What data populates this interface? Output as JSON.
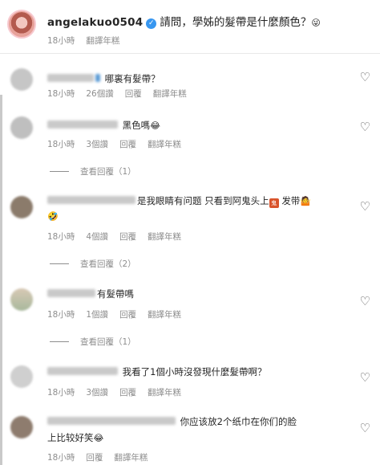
{
  "post": {
    "username": "angelakuo0504",
    "caption": "請問，學姊的髮帶是什麼顏色？",
    "caption_emoji": "😜",
    "time": "18小時",
    "translate": "翻譯年糕"
  },
  "icons": {
    "like": "heart-outline-icon",
    "verified": "verified-badge-icon"
  },
  "colors": {
    "verified": "#3897f0",
    "meta_text": "#8e8e8e"
  },
  "comments": [
    {
      "text": "哪裏有髮帶？",
      "time": "18小時",
      "likes": "26個讚",
      "reply": "回覆",
      "translate": "翻譯年糕"
    },
    {
      "text": "黑色嗎",
      "emoji": "😂",
      "time": "18小時",
      "likes": "3個讚",
      "reply": "回覆",
      "translate": "翻譯年糕",
      "view_replies": "查看回覆（1）"
    },
    {
      "text": "是我眼睛有问题 只看到阿鬼头上",
      "text2": "发带",
      "emoji": "🤷",
      "emoji2": "🤣",
      "time": "18小時",
      "likes": "4個讚",
      "reply": "回覆",
      "translate": "翻譯年糕",
      "view_replies": "查看回覆（2）"
    },
    {
      "text": "有髮帶嗎",
      "time": "18小時",
      "likes": "1個讚",
      "reply": "回覆",
      "translate": "翻譯年糕",
      "view_replies": "查看回覆（1）"
    },
    {
      "text": "我看了1個小時沒發現什麼髮帶啊？",
      "time": "18小時",
      "likes": "3個讚",
      "reply": "回覆",
      "translate": "翻譯年糕"
    },
    {
      "text": "你应该放2个纸巾在你们的脸",
      "text2": "上比较好笑",
      "emoji": "😂",
      "time": "18小時",
      "reply": "回覆",
      "translate": "翻譯年糕"
    }
  ]
}
